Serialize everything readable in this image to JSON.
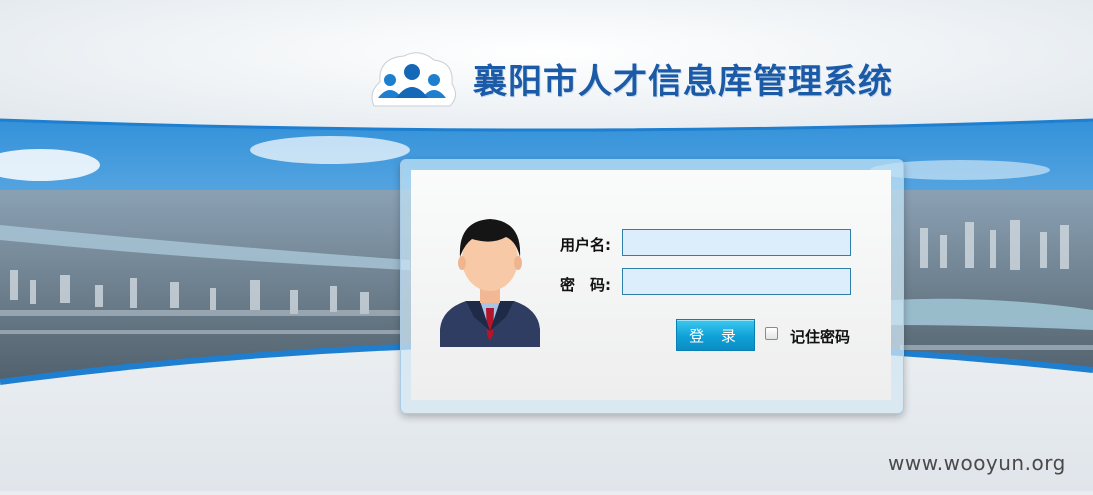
{
  "header": {
    "title": "襄阳市人才信息库管理系统"
  },
  "login": {
    "username_label": "用户名:",
    "password_label": "密　码:",
    "username_value": "",
    "password_value": "",
    "login_button": "登 录",
    "remember_label": "记住密码",
    "remember_checked": false
  },
  "footer": {
    "text": " "
  },
  "watermark": "www.wooyun.org",
  "colors": {
    "title": "#1a5aa7",
    "button": "#0fa1d7",
    "input_bg": "#dcedfc",
    "input_border": "#2f7fa8"
  },
  "icons": {
    "logo": "people-group-icon",
    "avatar": "user-avatar-icon"
  }
}
